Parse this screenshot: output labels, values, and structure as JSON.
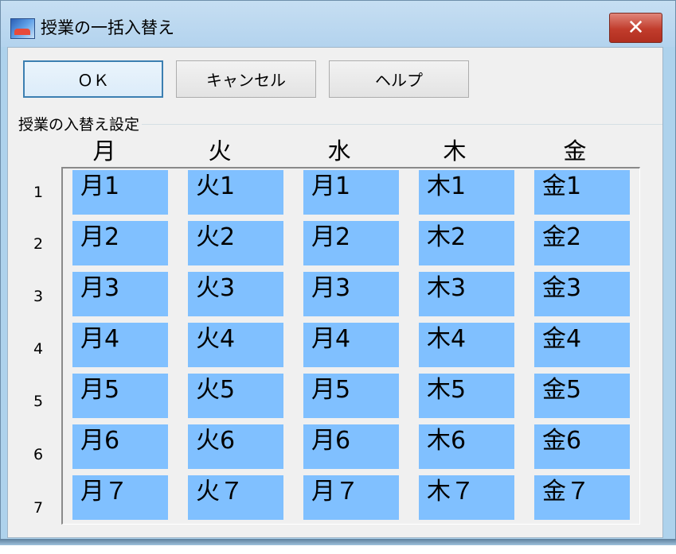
{
  "window": {
    "title": "授業の一括入替え",
    "close_glyph": "✕"
  },
  "buttons": {
    "ok": "ＯＫ",
    "cancel": "キャンセル",
    "help": "ヘルプ"
  },
  "group": {
    "label": "授業の入替え設定"
  },
  "days": [
    "月",
    "火",
    "水",
    "木",
    "金"
  ],
  "periods": [
    "1",
    "2",
    "3",
    "4",
    "5",
    "6",
    "7"
  ],
  "grid": [
    [
      "月1",
      "火1",
      "月1",
      "木1",
      "金1"
    ],
    [
      "月2",
      "火2",
      "月2",
      "木2",
      "金2"
    ],
    [
      "月3",
      "火3",
      "月3",
      "木3",
      "金3"
    ],
    [
      "月4",
      "火4",
      "月4",
      "木4",
      "金4"
    ],
    [
      "月5",
      "火5",
      "月5",
      "木5",
      "金5"
    ],
    [
      "月6",
      "火6",
      "月6",
      "木6",
      "金6"
    ],
    [
      "月７",
      "火７",
      "月７",
      "木７",
      "金７"
    ]
  ],
  "colors": {
    "cell_bg": "#80c0ff",
    "close_button": "#c13c2c",
    "titlebar": "#b9d7ef",
    "dialog_bg": "#f0f0f0"
  },
  "icons": {
    "app": "app-icon",
    "close": "close-icon"
  }
}
